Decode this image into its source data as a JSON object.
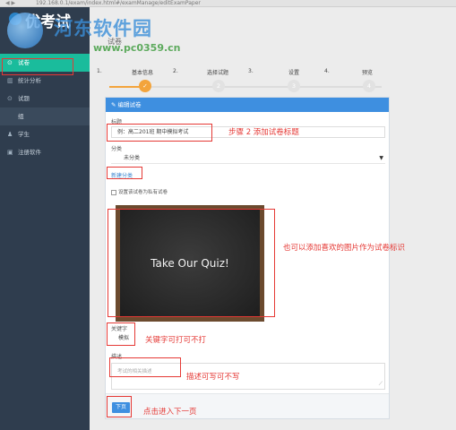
{
  "browser": {
    "nav": "◀ ▶",
    "url": "192.168.0.1/exam/index.html#/examManage/editExamPaper"
  },
  "sidebar": {
    "brand": "优考试",
    "items": [
      {
        "icon": "⊙",
        "label": "试卷",
        "active": true
      },
      {
        "icon": "▥",
        "label": "统计分析"
      },
      {
        "icon": "⊙",
        "label": "试题"
      },
      {
        "icon": "",
        "label": "组",
        "group": true
      },
      {
        "icon": "♟",
        "label": "学生"
      },
      {
        "icon": "▣",
        "label": "注册软件"
      }
    ]
  },
  "watermark": {
    "title": "河东软件园",
    "url": "www.pc0359.cn"
  },
  "page_title": "试卷",
  "steps": [
    {
      "num": "1.",
      "label": "基本信息",
      "circle": "✓"
    },
    {
      "num": "2.",
      "label": "选择试题",
      "circle": "2"
    },
    {
      "num": "3.",
      "label": "设置",
      "circle": "3"
    },
    {
      "num": "4.",
      "label": "预览",
      "circle": "4"
    }
  ],
  "panel": {
    "header": "编辑试卷",
    "title_label": "标题",
    "title_placeholder": "例：高二201班 期中模拟考试",
    "category_label": "分类",
    "category_value": "未分类",
    "category_caret": "▼",
    "new_category": "新建分类",
    "private_checkbox": "设置该试卷为私有试卷",
    "quiz_image_text": "Take Our Quiz!",
    "keyword_label": "关键字",
    "keyword_value": "模拟",
    "desc_label": "描述",
    "desc_placeholder": "考试的相关描述",
    "next_button": "下页"
  },
  "annotations": {
    "step2": "步骤 2 添加试卷标题",
    "image_note": "也可以添加喜欢的图片作为试卷标识",
    "keyword_note": "关键字可打可不打",
    "desc_note": "描述可写可不写",
    "next_note": "点击进入下一页"
  },
  "colors": {
    "sidebar": "#2f3d4e",
    "active": "#1abc9c",
    "accent": "#3e8fe0",
    "step": "#f3a43c",
    "annotation": "#e53935"
  }
}
